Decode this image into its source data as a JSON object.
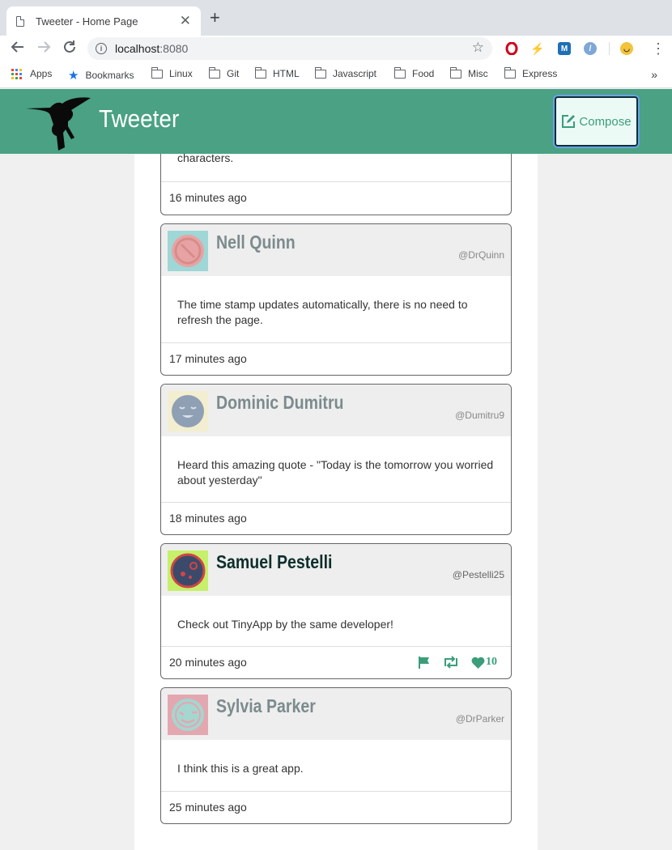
{
  "browser": {
    "tab_title": "Tweeter - Home Page",
    "close_glyph": "✕",
    "new_tab_glyph": "+",
    "url_host": "localhost",
    "url_port": ":8080",
    "bookmarks": [
      {
        "label": "Apps",
        "icon": "apps-grid-icon"
      },
      {
        "label": "Bookmarks",
        "icon": "star-icon"
      },
      {
        "label": "Linux",
        "icon": "folder-icon"
      },
      {
        "label": "Git",
        "icon": "folder-icon"
      },
      {
        "label": "HTML",
        "icon": "folder-icon"
      },
      {
        "label": "Javascript",
        "icon": "folder-icon"
      },
      {
        "label": "Food",
        "icon": "folder-icon"
      },
      {
        "label": "Misc",
        "icon": "folder-icon"
      },
      {
        "label": "Express",
        "icon": "folder-icon"
      }
    ],
    "more_glyph": "»"
  },
  "app": {
    "brand": "Tweeter",
    "compose_label": "Compose",
    "header_color": "#4aa183",
    "accent_color": "#3a9e7a"
  },
  "tweets": [
    {
      "body": "characters.",
      "time": "16 minutes ago"
    },
    {
      "name": "Nell Quinn",
      "handle": "@DrQuinn",
      "body": "The time stamp updates automatically, there is no need to refresh the page.",
      "time": "17 minutes ago"
    },
    {
      "name": "Dominic Dumitru",
      "handle": "@Dumitru9",
      "body": "Heard this amazing quote - \"Today is the tomorrow you worried about yesterday\"",
      "time": "18 minutes ago"
    },
    {
      "name": "Samuel Pestelli",
      "handle": "@Pestelli25",
      "body": "Check out TinyApp by the same developer!",
      "time": "20 minutes ago",
      "likes": "10"
    },
    {
      "name": "Sylvia Parker",
      "handle": "@DrParker",
      "body": "I think this is a great app.",
      "time": "25 minutes ago"
    }
  ]
}
